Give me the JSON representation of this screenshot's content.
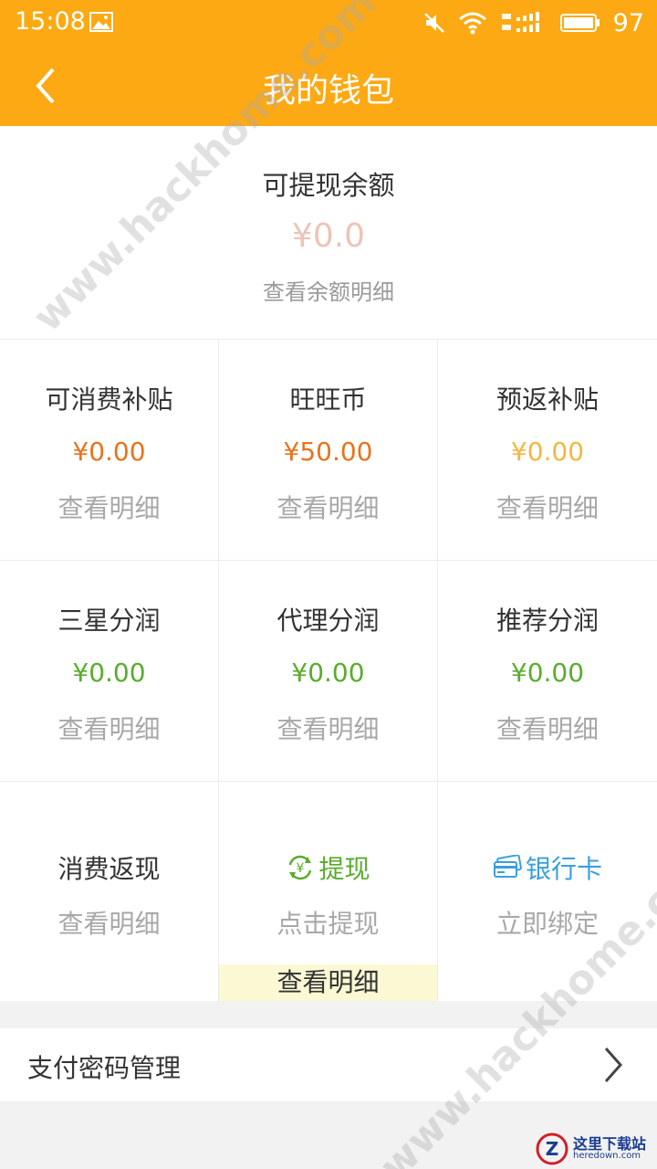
{
  "status_bar": {
    "time": "15:08",
    "battery_level": "97"
  },
  "app_bar": {
    "title": "我的钱包"
  },
  "balance": {
    "title": "可提现余额",
    "amount": "¥0.0",
    "link": "查看余额明细"
  },
  "grid": {
    "row1": [
      {
        "title": "可消费补贴",
        "amount": "¥0.00",
        "amount_color": "#e8731c",
        "link": "查看明细"
      },
      {
        "title": "旺旺币",
        "amount": "¥50.00",
        "amount_color": "#e8731c",
        "link": "查看明细"
      },
      {
        "title": "预返补贴",
        "amount": "¥0.00",
        "amount_color": "#f4b73e",
        "link": "查看明细"
      }
    ],
    "row2": [
      {
        "title": "三星分润",
        "amount": "¥0.00",
        "amount_color": "#5aac2e",
        "link": "查看明细"
      },
      {
        "title": "代理分润",
        "amount": "¥0.00",
        "amount_color": "#5aac2e",
        "link": "查看明细"
      },
      {
        "title": "推荐分润",
        "amount": "¥0.00",
        "amount_color": "#5aac2e",
        "link": "查看明细"
      }
    ],
    "row3": {
      "cashback": {
        "title": "消费返现",
        "link": "查看明细"
      },
      "withdraw": {
        "title": "提现",
        "link": "点击提现",
        "detail": "查看明细",
        "color": "#5aac2e"
      },
      "bankcard": {
        "title": "银行卡",
        "link": "立即绑定",
        "color": "#3a9ee0"
      }
    }
  },
  "password_row": {
    "label": "支付密码管理"
  },
  "watermark": {
    "text": "www.hackhome.com"
  },
  "corner_logo": {
    "cn": "这里下载站",
    "en": "heredown.com"
  },
  "colors": {
    "primary": "#fda913"
  }
}
